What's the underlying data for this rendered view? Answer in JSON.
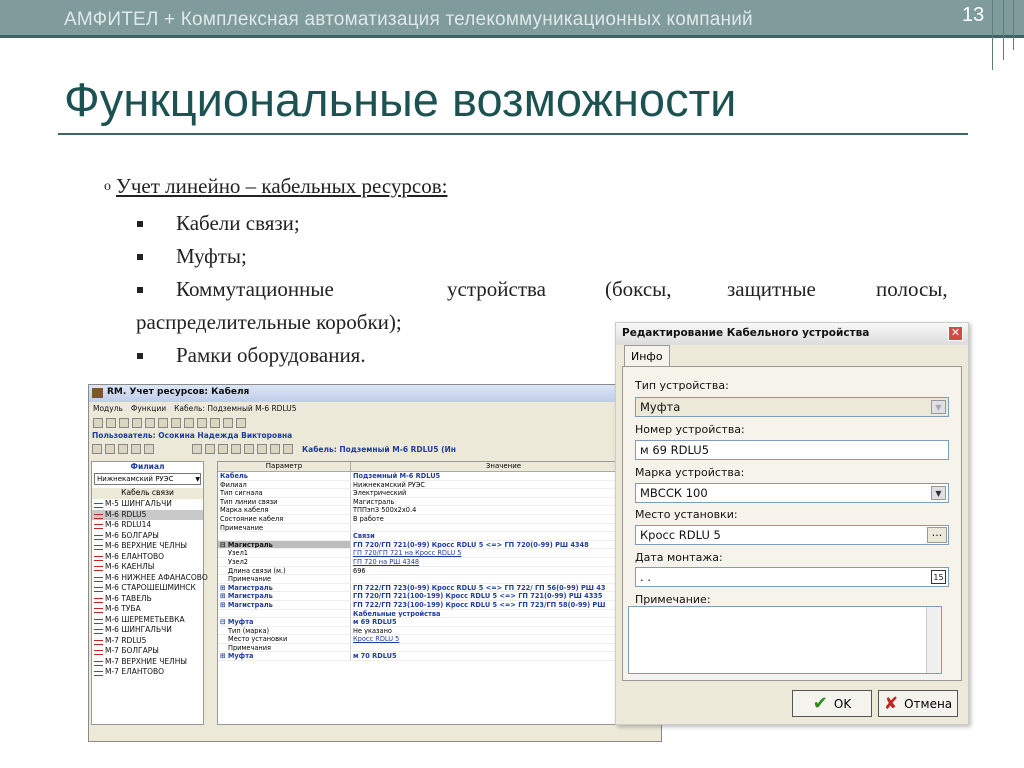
{
  "header": {
    "title": "АМФИТЕЛ + Комплексная автоматизация телекоммуникационных компаний",
    "slide_number": "13"
  },
  "slide": {
    "title": "Функциональные возможности",
    "point": "Учет линейно – кабельных ресурсов:",
    "bullets": [
      "Кабели связи;",
      "Муфты;",
      "Коммутационные",
      "устройства",
      "(боксы,",
      "защитные",
      "полосы,",
      "распределительные коробки);",
      "Рамки оборудования."
    ]
  },
  "win1": {
    "title": "RM. Учет ресурсов: Кабеля",
    "menu": [
      "Модуль",
      "Функции",
      "Кабель: Подземный М-6 RDLU5"
    ],
    "user": "Пользователь: Осокина Надежда Викторовна",
    "cable_label": "Кабель: Подземный М-6 RDLU5 (Ин",
    "filial_h": "Филиал",
    "filial_v": "Нижнекамский РУЭС",
    "cables_h": "Кабель связи",
    "cables": [
      "М-5 ШИНГАЛЬЧИ",
      "М-6 RDLU5",
      "М-6 RDLU14",
      "М-6 БОЛГАРЫ",
      "М-6 ВЕРХНИЕ ЧЕЛНЫ",
      "М-6 ЕЛАНТОВО",
      "М-6 КАЕНЛЫ",
      "М-6 НИЖНЕЕ АФАНАСОВО",
      "М-6 СТАРОШЕШМИНСК",
      "М-6 ТАВЕЛЬ",
      "М-6 ТУБА",
      "М-6 ШЕРЕМЕТЬЕВКА",
      "М-6 ШИНГАЛЬЧИ",
      "М-7 RDLU5",
      "М-7 БОЛГАРЫ",
      "М-7 ВЕРХНИЕ ЧЕЛНЫ",
      "М-7 ЕЛАНТОВО"
    ],
    "col_param": "Параметр",
    "col_value": "Значение",
    "rows": [
      {
        "p": "Кабель",
        "v": "Подземный М-6 RDLU5"
      },
      {
        "p": "Филиал",
        "v": "Нижнекамский РУЭС"
      },
      {
        "p": "Тип сигнала",
        "v": "Электрический"
      },
      {
        "p": "Тип линии связи",
        "v": "Магистраль"
      },
      {
        "p": "Марка кабеля",
        "v": "ТППэпЗ 500х2х0.4"
      },
      {
        "p": "Состояние кабеля",
        "v": "В работе"
      },
      {
        "p": "Примечание",
        "v": ""
      },
      {
        "p": "",
        "v": "Связи"
      },
      {
        "p": "⊟ Магистраль",
        "v": "ГП 720/ГП 721(0-99) Кросс RDLU 5 <=> ГП 720(0-99) РШ 4348"
      },
      {
        "p": "Узел1",
        "v": "ГП 720/ГП 721 на Кросс RDLU 5"
      },
      {
        "p": "Узел2",
        "v": "ГП 720 на РШ 4348"
      },
      {
        "p": "Длина связи (м.)",
        "v": "696"
      },
      {
        "p": "Примечание",
        "v": ""
      },
      {
        "p": "⊞ Магистраль",
        "v": "ГП 722/ГП 723(0-99) Кросс RDLU 5 <=> ГП 722/ ГП 56(0-99) РШ 43"
      },
      {
        "p": "⊞ Магистраль",
        "v": "ГП 720/ГП 721(100-199) Кросс RDLU 5 <=> ГП 721(0-99) РШ 4335"
      },
      {
        "p": "⊞ Магистраль",
        "v": "ГП 722/ГП 723(100-199) Кросс RDLU 5 <=> ГП 723/ГП 58(0-99) РШ"
      },
      {
        "p": "",
        "v": "Кабельные устройства"
      },
      {
        "p": "⊟ Муфта",
        "v": "м 69 RDLU5"
      },
      {
        "p": "Тип (марка)",
        "v": "Не указано"
      },
      {
        "p": "Место установки",
        "v": "Кросс RDLU 5"
      },
      {
        "p": "Примечания",
        "v": ""
      },
      {
        "p": "⊞ Муфта",
        "v": "м 70 RDLU5"
      }
    ]
  },
  "dialog": {
    "title": "Редактирование Кабельного устройства",
    "tab": "Инфо",
    "type_label": "Тип устройства:",
    "type_value": "Муфта",
    "number_label": "Номер устройства:",
    "number_value": "м 69 RDLU5",
    "brand_label": "Марка устройства:",
    "brand_value": "МВССК 100",
    "place_label": "Место установки:",
    "place_value": "Кросс RDLU 5",
    "date_label": "Дата монтажа:",
    "date_value": ". .",
    "note_label": "Примечание:",
    "ok": "OK",
    "cancel": "Отмена"
  }
}
